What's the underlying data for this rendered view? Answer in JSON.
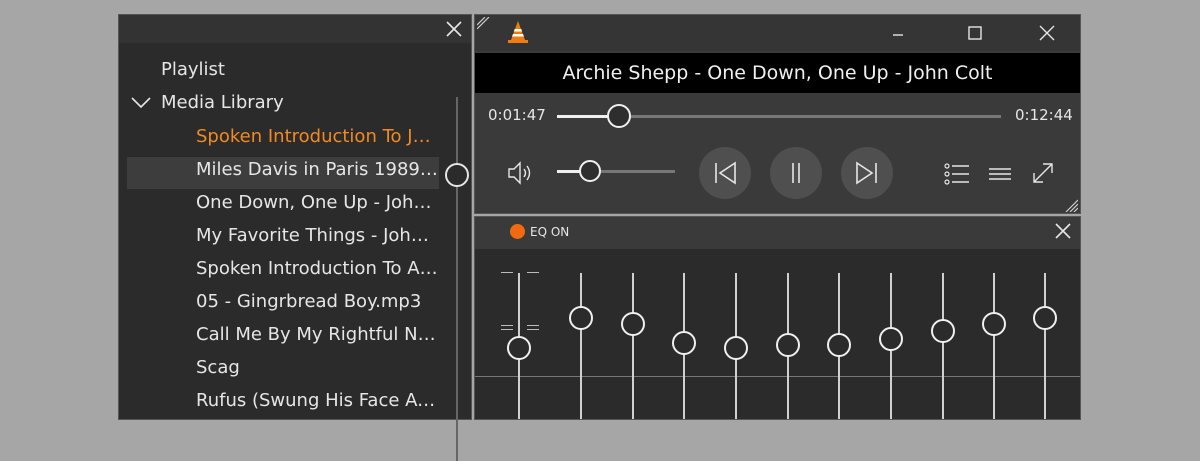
{
  "playlist": {
    "heading": "Playlist",
    "media_library": "Media Library",
    "items": [
      {
        "label": "Spoken Introduction To Jo...",
        "active": true
      },
      {
        "label": "Miles Davis in Paris 1989 [L...",
        "active": false
      },
      {
        "label": "One Down, One Up - John...",
        "active": false
      },
      {
        "label": "My Favorite Things - John ...",
        "active": false
      },
      {
        "label": "Spoken Introduction To Ar...",
        "active": false
      },
      {
        "label": "05 - Gingrbread Boy.mp3",
        "active": false
      },
      {
        "label": "Call Me By My Rightful Na...",
        "active": false
      },
      {
        "label": "Scag",
        "active": false
      },
      {
        "label": "Rufus (Swung His Face At ...",
        "active": false
      }
    ]
  },
  "player": {
    "now_playing": "Archie Shepp - One Down, One Up - John Colt",
    "elapsed": "0:01:47",
    "total": "0:12:44",
    "progress_fraction": 0.14,
    "volume_fraction": 0.28,
    "icons": {
      "logo": "vlc-cone-icon",
      "minimize": "minimize-icon",
      "maximize": "maximize-icon",
      "close": "close-icon",
      "volume": "speaker-icon",
      "prev": "skip-previous-icon",
      "pause": "pause-icon",
      "next": "skip-next-icon",
      "playlist": "playlist-icon",
      "menu": "menu-icon",
      "fullscreen": "fullscreen-icon"
    }
  },
  "equalizer": {
    "state_label": "EQ ON",
    "accent": "#f26a10",
    "band_levels": [
      0.5,
      0.78,
      0.72,
      0.54,
      0.5,
      0.52,
      0.52,
      0.58,
      0.66,
      0.72,
      0.78
    ]
  },
  "colors": {
    "active_item": "#f08a24",
    "background": "#a6a6a6",
    "panel": "#2b2b2b"
  }
}
